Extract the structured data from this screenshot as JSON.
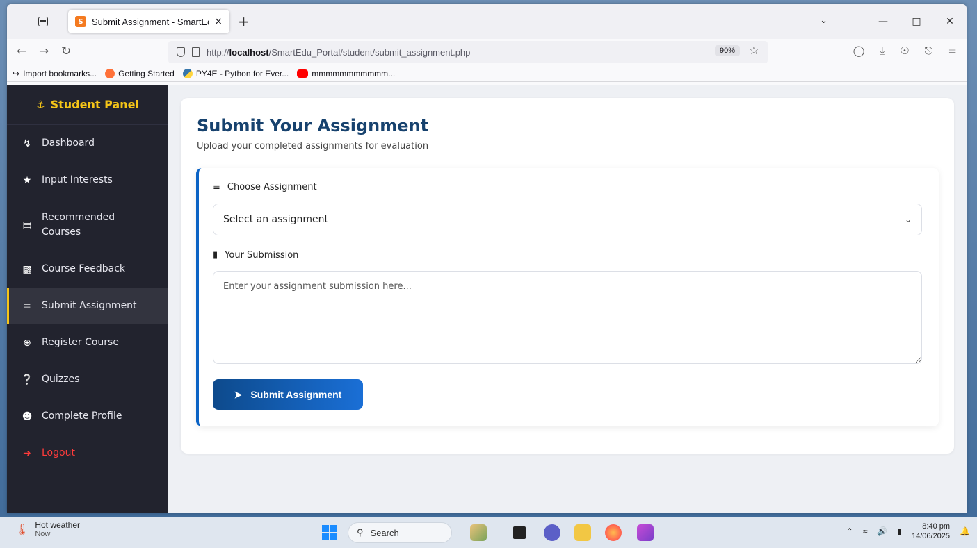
{
  "browser": {
    "tab_title": "Submit Assignment - SmartEdu",
    "tab_close": "×",
    "new_tab": "+",
    "url_host": "localhost",
    "url_prefix": "http://",
    "url_path": "/SmartEdu_Portal/student/submit_assignment.php",
    "zoom": "90%",
    "bookmarks": [
      "Import bookmarks...",
      "Getting Started",
      "PY4E - Python for Ever...",
      "mmmmmmmmmmm..."
    ]
  },
  "sidebar": {
    "brand": "Student Panel",
    "items": [
      {
        "label": "Dashboard",
        "icon": "chart-line-icon"
      },
      {
        "label": "Input Interests",
        "icon": "star-icon"
      },
      {
        "label": "Recommended Courses",
        "icon": "book-icon"
      },
      {
        "label": "Course Feedback",
        "icon": "comment-icon"
      },
      {
        "label": "Submit Assignment",
        "icon": "list-check-icon",
        "active": true
      },
      {
        "label": "Register Course",
        "icon": "plus-circle-icon"
      },
      {
        "label": "Quizzes",
        "icon": "question-circle-icon"
      },
      {
        "label": "Complete Profile",
        "icon": "user-edit-icon"
      },
      {
        "label": "Logout",
        "icon": "sign-out-icon"
      }
    ]
  },
  "main": {
    "title": "Submit Your Assignment",
    "subtitle": "Upload your completed assignments for evaluation",
    "choose_label": "Choose Assignment",
    "select_value": "Select an assignment",
    "submission_label": "Your Submission",
    "textarea_placeholder": "Enter your assignment submission here...",
    "submit_label": "Submit Assignment"
  },
  "taskbar": {
    "weather_title": "Hot weather",
    "weather_sub": "Now",
    "search_label": "Search",
    "time": "8:40 pm",
    "date": "14/06/2025"
  },
  "colors": {
    "sidebar_bg": "#22232e",
    "brand": "#f5c518",
    "title": "#17426e",
    "accent": "#0b63c5",
    "logout": "#ff3b3b"
  }
}
